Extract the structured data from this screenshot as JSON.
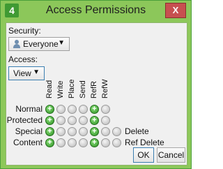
{
  "window": {
    "title": "Access Permissions",
    "app_icon_glyph": "4",
    "close_glyph": "X"
  },
  "security": {
    "label": "Security:",
    "value": "Everyone"
  },
  "access": {
    "label": "Access:",
    "value": "View"
  },
  "grid": {
    "columns": [
      "Read",
      "Write",
      "Place",
      "Send",
      "RefR",
      "RefW"
    ],
    "rows": [
      {
        "label": "Normal",
        "states": [
          true,
          false,
          false,
          false,
          true,
          false
        ],
        "extra": null
      },
      {
        "label": "Protected",
        "states": [
          true,
          false,
          false,
          false,
          true,
          false
        ],
        "extra": null
      },
      {
        "label": "Special",
        "states": [
          true,
          false,
          false,
          false,
          true,
          false,
          false
        ],
        "extra": "Delete"
      },
      {
        "label": "Content",
        "states": [
          true,
          false,
          false,
          false,
          true,
          false,
          false
        ],
        "extra": "Ref Delete"
      }
    ]
  },
  "buttons": {
    "ok": "OK",
    "cancel": "Cancel"
  }
}
